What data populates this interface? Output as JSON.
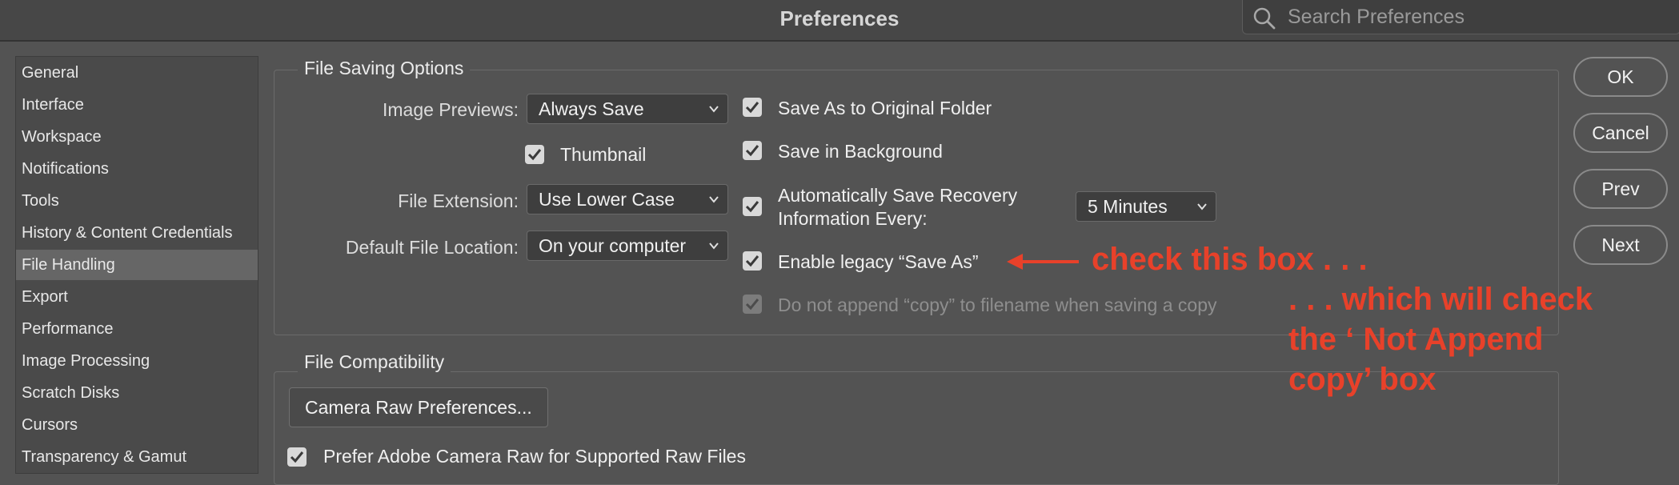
{
  "window": {
    "title": "Preferences"
  },
  "search": {
    "placeholder": "Search Preferences"
  },
  "sidebar": {
    "items": [
      {
        "label": "General"
      },
      {
        "label": "Interface"
      },
      {
        "label": "Workspace"
      },
      {
        "label": "Notifications"
      },
      {
        "label": "Tools"
      },
      {
        "label": "History & Content Credentials"
      },
      {
        "label": "File Handling",
        "selected": true
      },
      {
        "label": "Export"
      },
      {
        "label": "Performance"
      },
      {
        "label": "Image Processing"
      },
      {
        "label": "Scratch Disks"
      },
      {
        "label": "Cursors"
      },
      {
        "label": "Transparency & Gamut"
      }
    ]
  },
  "file_saving": {
    "title": "File Saving Options",
    "image_previews": {
      "label": "Image Previews:",
      "value": "Always Save"
    },
    "thumbnail": {
      "label": "Thumbnail",
      "checked": true
    },
    "file_extension": {
      "label": "File Extension:",
      "value": "Use Lower Case"
    },
    "default_location": {
      "label": "Default File Location:",
      "value": "On your computer"
    },
    "save_as_original": {
      "label": "Save As to Original Folder",
      "checked": true
    },
    "save_background": {
      "label": "Save in Background",
      "checked": true
    },
    "auto_recovery": {
      "label_line1": "Automatically Save Recovery",
      "label_line2": "Information Every:",
      "checked": true,
      "interval": "5 Minutes"
    },
    "legacy_save_as": {
      "label": "Enable legacy “Save As”",
      "checked": true
    },
    "no_append_copy": {
      "label": "Do not append “copy” to filename when saving a copy",
      "checked": true,
      "disabled": true
    }
  },
  "file_compat": {
    "title": "File Compatibility",
    "camera_raw_button": "Camera Raw Preferences...",
    "prefer_acr": {
      "label": "Prefer Adobe Camera Raw for Supported Raw Files",
      "checked": true
    }
  },
  "buttons": {
    "ok": "OK",
    "cancel": "Cancel",
    "prev": "Prev",
    "next": "Next"
  },
  "annotations": {
    "check_box": "check this box . . .",
    "line1": ". . . which will check",
    "line2": "the ‘ Not Append",
    "line3": "copy’ box",
    "color": "#e8412a"
  }
}
